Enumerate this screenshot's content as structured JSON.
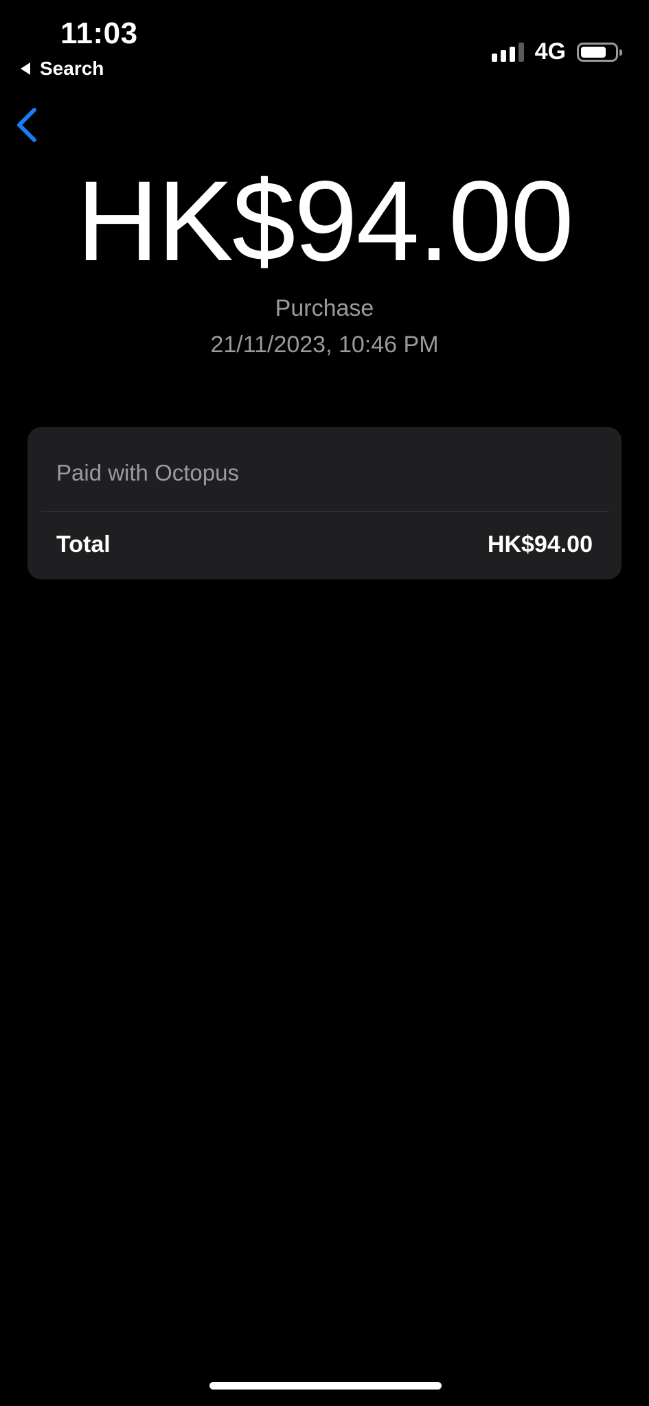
{
  "status_bar": {
    "time": "11:03",
    "back_app_label": "Search",
    "network": "4G",
    "signal_bars_filled": 3,
    "signal_bars_total": 4,
    "battery_level": 0.75
  },
  "nav": {
    "back_icon": "chevron-left-icon",
    "accent_color": "#1a7cf5"
  },
  "transaction": {
    "amount": "HK$94.00",
    "type": "Purchase",
    "datetime": "21/11/2023, 10:46 PM"
  },
  "details_card": {
    "payment_note": "Paid with Octopus",
    "total_label": "Total",
    "total_value": "HK$94.00"
  }
}
